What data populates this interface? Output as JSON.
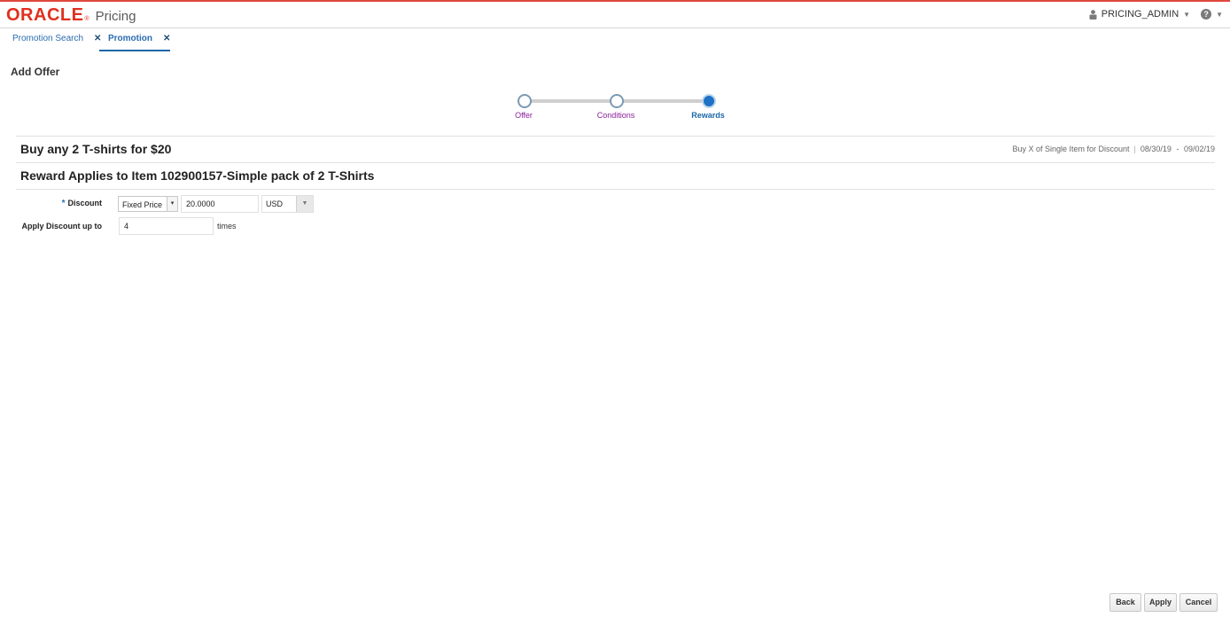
{
  "brand": {
    "logo_text": "ORACLE",
    "product": "Pricing"
  },
  "header": {
    "user_name": "PRICING_ADMIN",
    "help_glyph": "?"
  },
  "tabs": [
    {
      "label": "Promotion Search",
      "active": false
    },
    {
      "label": "Promotion",
      "active": true
    }
  ],
  "page": {
    "title": "Add Offer"
  },
  "train": {
    "stops": [
      {
        "label": "Offer",
        "state": "visited"
      },
      {
        "label": "Conditions",
        "state": "visited"
      },
      {
        "label": "Rewards",
        "state": "current"
      }
    ]
  },
  "offer": {
    "name": "Buy any 2 T-shirts for $20",
    "type": "Buy X of Single Item for Discount",
    "start_date": "08/30/19",
    "end_date": "09/02/19",
    "date_separator": "-"
  },
  "reward": {
    "heading": "Reward Applies to Item 102900157-Simple pack of 2 T-Shirts"
  },
  "form": {
    "discount_label": "Discount",
    "discount_type": "Fixed Price",
    "discount_value": "20.0000",
    "currency": "USD",
    "apply_up_to_label": "Apply Discount up to",
    "apply_up_to_value": "4",
    "times_label": "times"
  },
  "buttons": {
    "back": "Back",
    "apply": "Apply",
    "cancel": "Cancel"
  },
  "colors": {
    "brand_red": "#e0301e",
    "link_blue": "#2b6cb0",
    "visited_purple": "#8a1f9a",
    "current_blue": "#1d72c5"
  }
}
